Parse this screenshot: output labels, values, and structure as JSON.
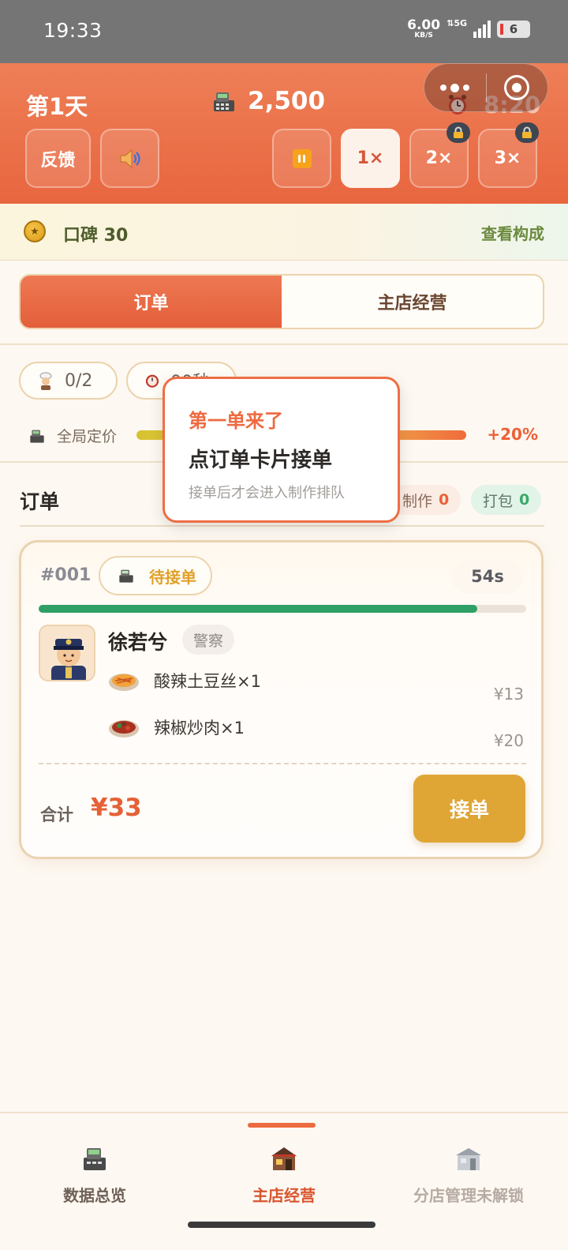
{
  "status_bar": {
    "time": "19:33",
    "net_speed": "6.00",
    "net_unit": "KB/S",
    "network": "5G",
    "battery": "6"
  },
  "header": {
    "day": "第1天",
    "money": "2,500",
    "clock": "8:20",
    "feedback_label": "反馈",
    "speed_1x": "1×",
    "speed_2x": "2×",
    "speed_3x": "3×",
    "active_speed": "1×",
    "locked_speeds": [
      "2×",
      "3×"
    ],
    "icons": [
      "cash-register-icon",
      "alarm-clock-icon",
      "speaker-icon",
      "pause-icon",
      "lock-icon",
      "more-dots-icon",
      "target-icon"
    ]
  },
  "reputation": {
    "text": "口碑 30",
    "link": "查看构成"
  },
  "main_tabs": [
    {
      "label": "订单",
      "active": true
    },
    {
      "label": "主店经营",
      "active": false
    }
  ],
  "stats": {
    "chefs": "0/2",
    "timer": "00秒",
    "pricing_label": "全局定价",
    "pricing_value": "+20%"
  },
  "orders": {
    "title": "订单",
    "making_label": "制作",
    "making_count": "0",
    "packing_label": "打包",
    "packing_count": "0"
  },
  "order_card": {
    "id": "#001",
    "status": "待接单",
    "countdown": "54s",
    "progress": 0.9,
    "customer_name": "徐若兮",
    "customer_role": "警察",
    "items": [
      {
        "name": "酸辣土豆丝×1",
        "price": "¥13"
      },
      {
        "name": "辣椒炒肉×1",
        "price": "¥20"
      }
    ],
    "total_label": "合计",
    "total": "¥33",
    "accept_label": "接单"
  },
  "tooltip": {
    "title": "第一单来了",
    "main": "点订单卡片接单",
    "sub": "接单后才会进入制作排队"
  },
  "bottom_nav": [
    {
      "label": "数据总览",
      "icon": "cash-register-icon",
      "active": false
    },
    {
      "label": "主店经营",
      "icon": "restaurant-icon",
      "active": true
    },
    {
      "label": "分店管理未解锁",
      "icon": "branch-store-icon",
      "active": false
    }
  ],
  "colors": {
    "accent": "#e8663f",
    "gold": "#dfa636",
    "green": "#2fa065"
  }
}
